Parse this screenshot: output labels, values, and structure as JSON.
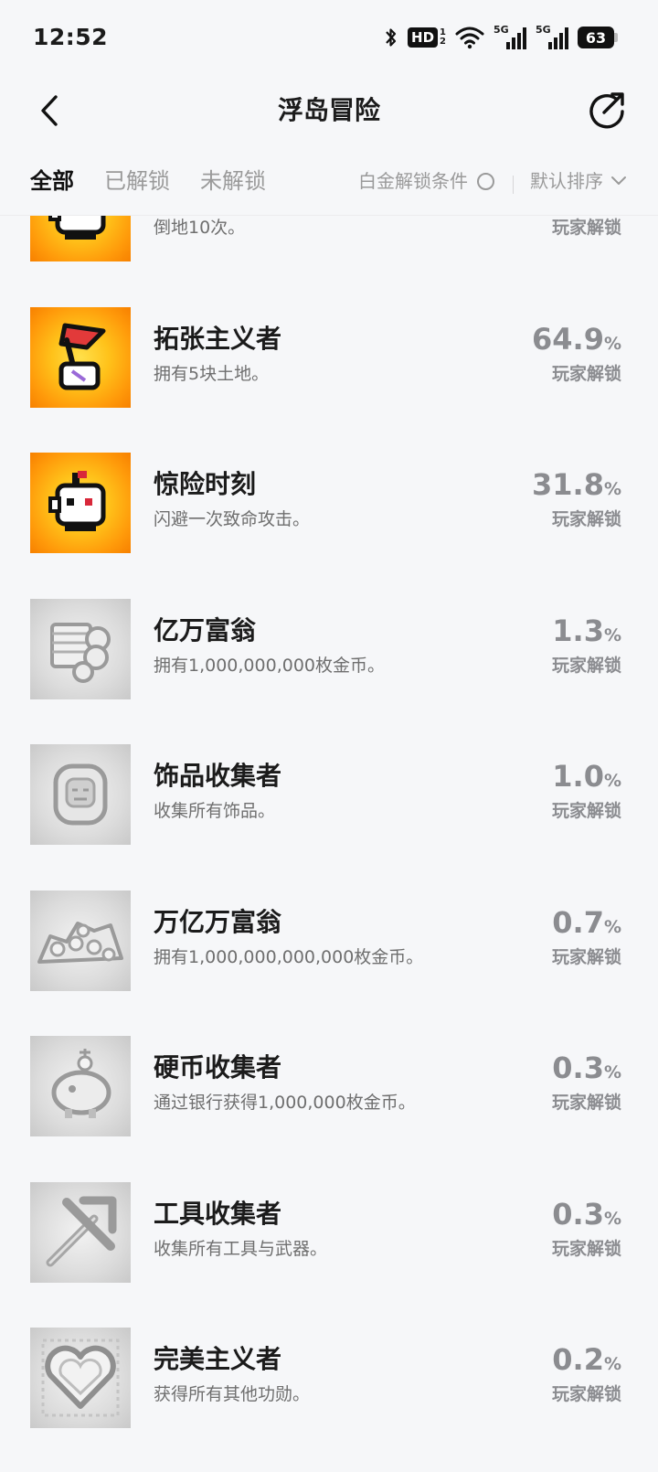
{
  "status_bar": {
    "time": "12:52",
    "hd_label": "HD",
    "hd_sub_top": "1",
    "hd_sub_bottom": "2",
    "sim1_gen": "5G",
    "sim2_gen": "5G",
    "battery": "63"
  },
  "header": {
    "title": "浮岛冒险",
    "back_icon": "chevron-left-icon",
    "share_icon": "share-icon"
  },
  "tabs": [
    {
      "label": "全部",
      "active": true
    },
    {
      "label": "已解锁",
      "active": false
    },
    {
      "label": "未解锁",
      "active": false
    }
  ],
  "filter": {
    "platinum_label": "白金解锁条件",
    "platinum_checked": false,
    "sort_label": "默认排序"
  },
  "colors": {
    "background": "#f6f7f9",
    "text_primary": "#1b1b1b",
    "text_secondary": "#6f6f6f",
    "percent": "#8b8c90",
    "badge_gold": "#ffb01a",
    "badge_gray": "#d7d7d7"
  },
  "achievements": [
    {
      "name": "",
      "desc": "倒地10次。",
      "percent": "",
      "unit": "",
      "unlock_label": "玩家解锁",
      "unlocked": true,
      "icon": "robot-icon"
    },
    {
      "name": "拓张主义者",
      "desc": "拥有5块土地。",
      "percent": "64.9",
      "unit": "%",
      "unlock_label": "玩家解锁",
      "unlocked": true,
      "icon": "flag-icon"
    },
    {
      "name": "惊险时刻",
      "desc": "闪避一次致命攻击。",
      "percent": "31.8",
      "unit": "%",
      "unlock_label": "玩家解锁",
      "unlocked": true,
      "icon": "robot-icon"
    },
    {
      "name": "亿万富翁",
      "desc": "拥有1,000,000,000枚金币。",
      "percent": "1.3",
      "unit": "%",
      "unlock_label": "玩家解锁",
      "unlocked": false,
      "icon": "coin-stack-icon"
    },
    {
      "name": "饰品收集者",
      "desc": "收集所有饰品。",
      "percent": "1.0",
      "unit": "%",
      "unlock_label": "玩家解锁",
      "unlocked": false,
      "icon": "trinket-icon"
    },
    {
      "name": "万亿万富翁",
      "desc": "拥有1,000,000,000,000枚金币。",
      "percent": "0.7",
      "unit": "%",
      "unlock_label": "玩家解锁",
      "unlocked": false,
      "icon": "coin-pile-icon"
    },
    {
      "name": "硬币收集者",
      "desc": "通过银行获得1,000,000枚金币。",
      "percent": "0.3",
      "unit": "%",
      "unlock_label": "玩家解锁",
      "unlocked": false,
      "icon": "piggy-bank-icon"
    },
    {
      "name": "工具收集者",
      "desc": "收集所有工具与武器。",
      "percent": "0.3",
      "unit": "%",
      "unlock_label": "玩家解锁",
      "unlocked": false,
      "icon": "pickaxe-icon"
    },
    {
      "name": "完美主义者",
      "desc": "获得所有其他功勋。",
      "percent": "0.2",
      "unit": "%",
      "unlock_label": "玩家解锁",
      "unlocked": false,
      "icon": "heart-icon"
    }
  ]
}
